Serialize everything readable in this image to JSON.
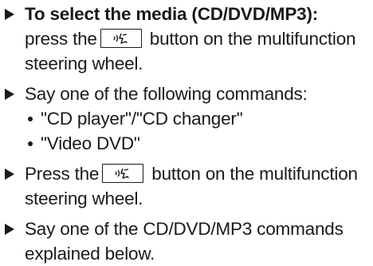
{
  "steps": [
    {
      "heading": "To select the media (CD/DVD/MP3):",
      "pre": "press the",
      "post": " button on the multifunction steering wheel."
    },
    {
      "text": "Say one of the following commands:",
      "bullets": [
        "\"CD player\"/\"CD changer\"",
        "\"Video DVD\""
      ]
    },
    {
      "pre": "Press the",
      "post": " button on the multifunction steering wheel."
    },
    {
      "text": "Say one of the CD/DVD/MP3 commands explained below."
    }
  ],
  "icons": {
    "arrow": "triangle-arrow-icon",
    "voice_button": "voice-control-button-icon",
    "bullet": "bullet-dot-icon"
  }
}
